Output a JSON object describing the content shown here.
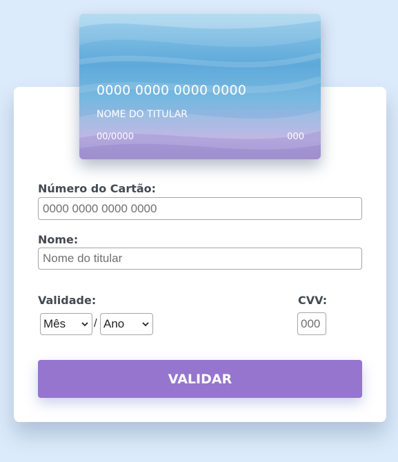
{
  "card_preview": {
    "number": "0000 0000 0000 0000",
    "holder": "NOME DO TITULAR",
    "expiry": "00/0000",
    "cvv": "000"
  },
  "form": {
    "card_number_label": "Número do Cartão:",
    "card_number_placeholder": "0000 0000 0000 0000",
    "name_label": "Nome:",
    "name_placeholder": "Nome do titular",
    "expiry_label": "Validade:",
    "month_selected": "Mês",
    "year_selected": "Ano",
    "expiry_separator": "/",
    "cvv_label": "CVV:",
    "cvv_placeholder": "000",
    "submit_label": "VALIDAR"
  },
  "colors": {
    "background": "#dcebfb",
    "button": "#9575cd",
    "label": "#444a52"
  }
}
